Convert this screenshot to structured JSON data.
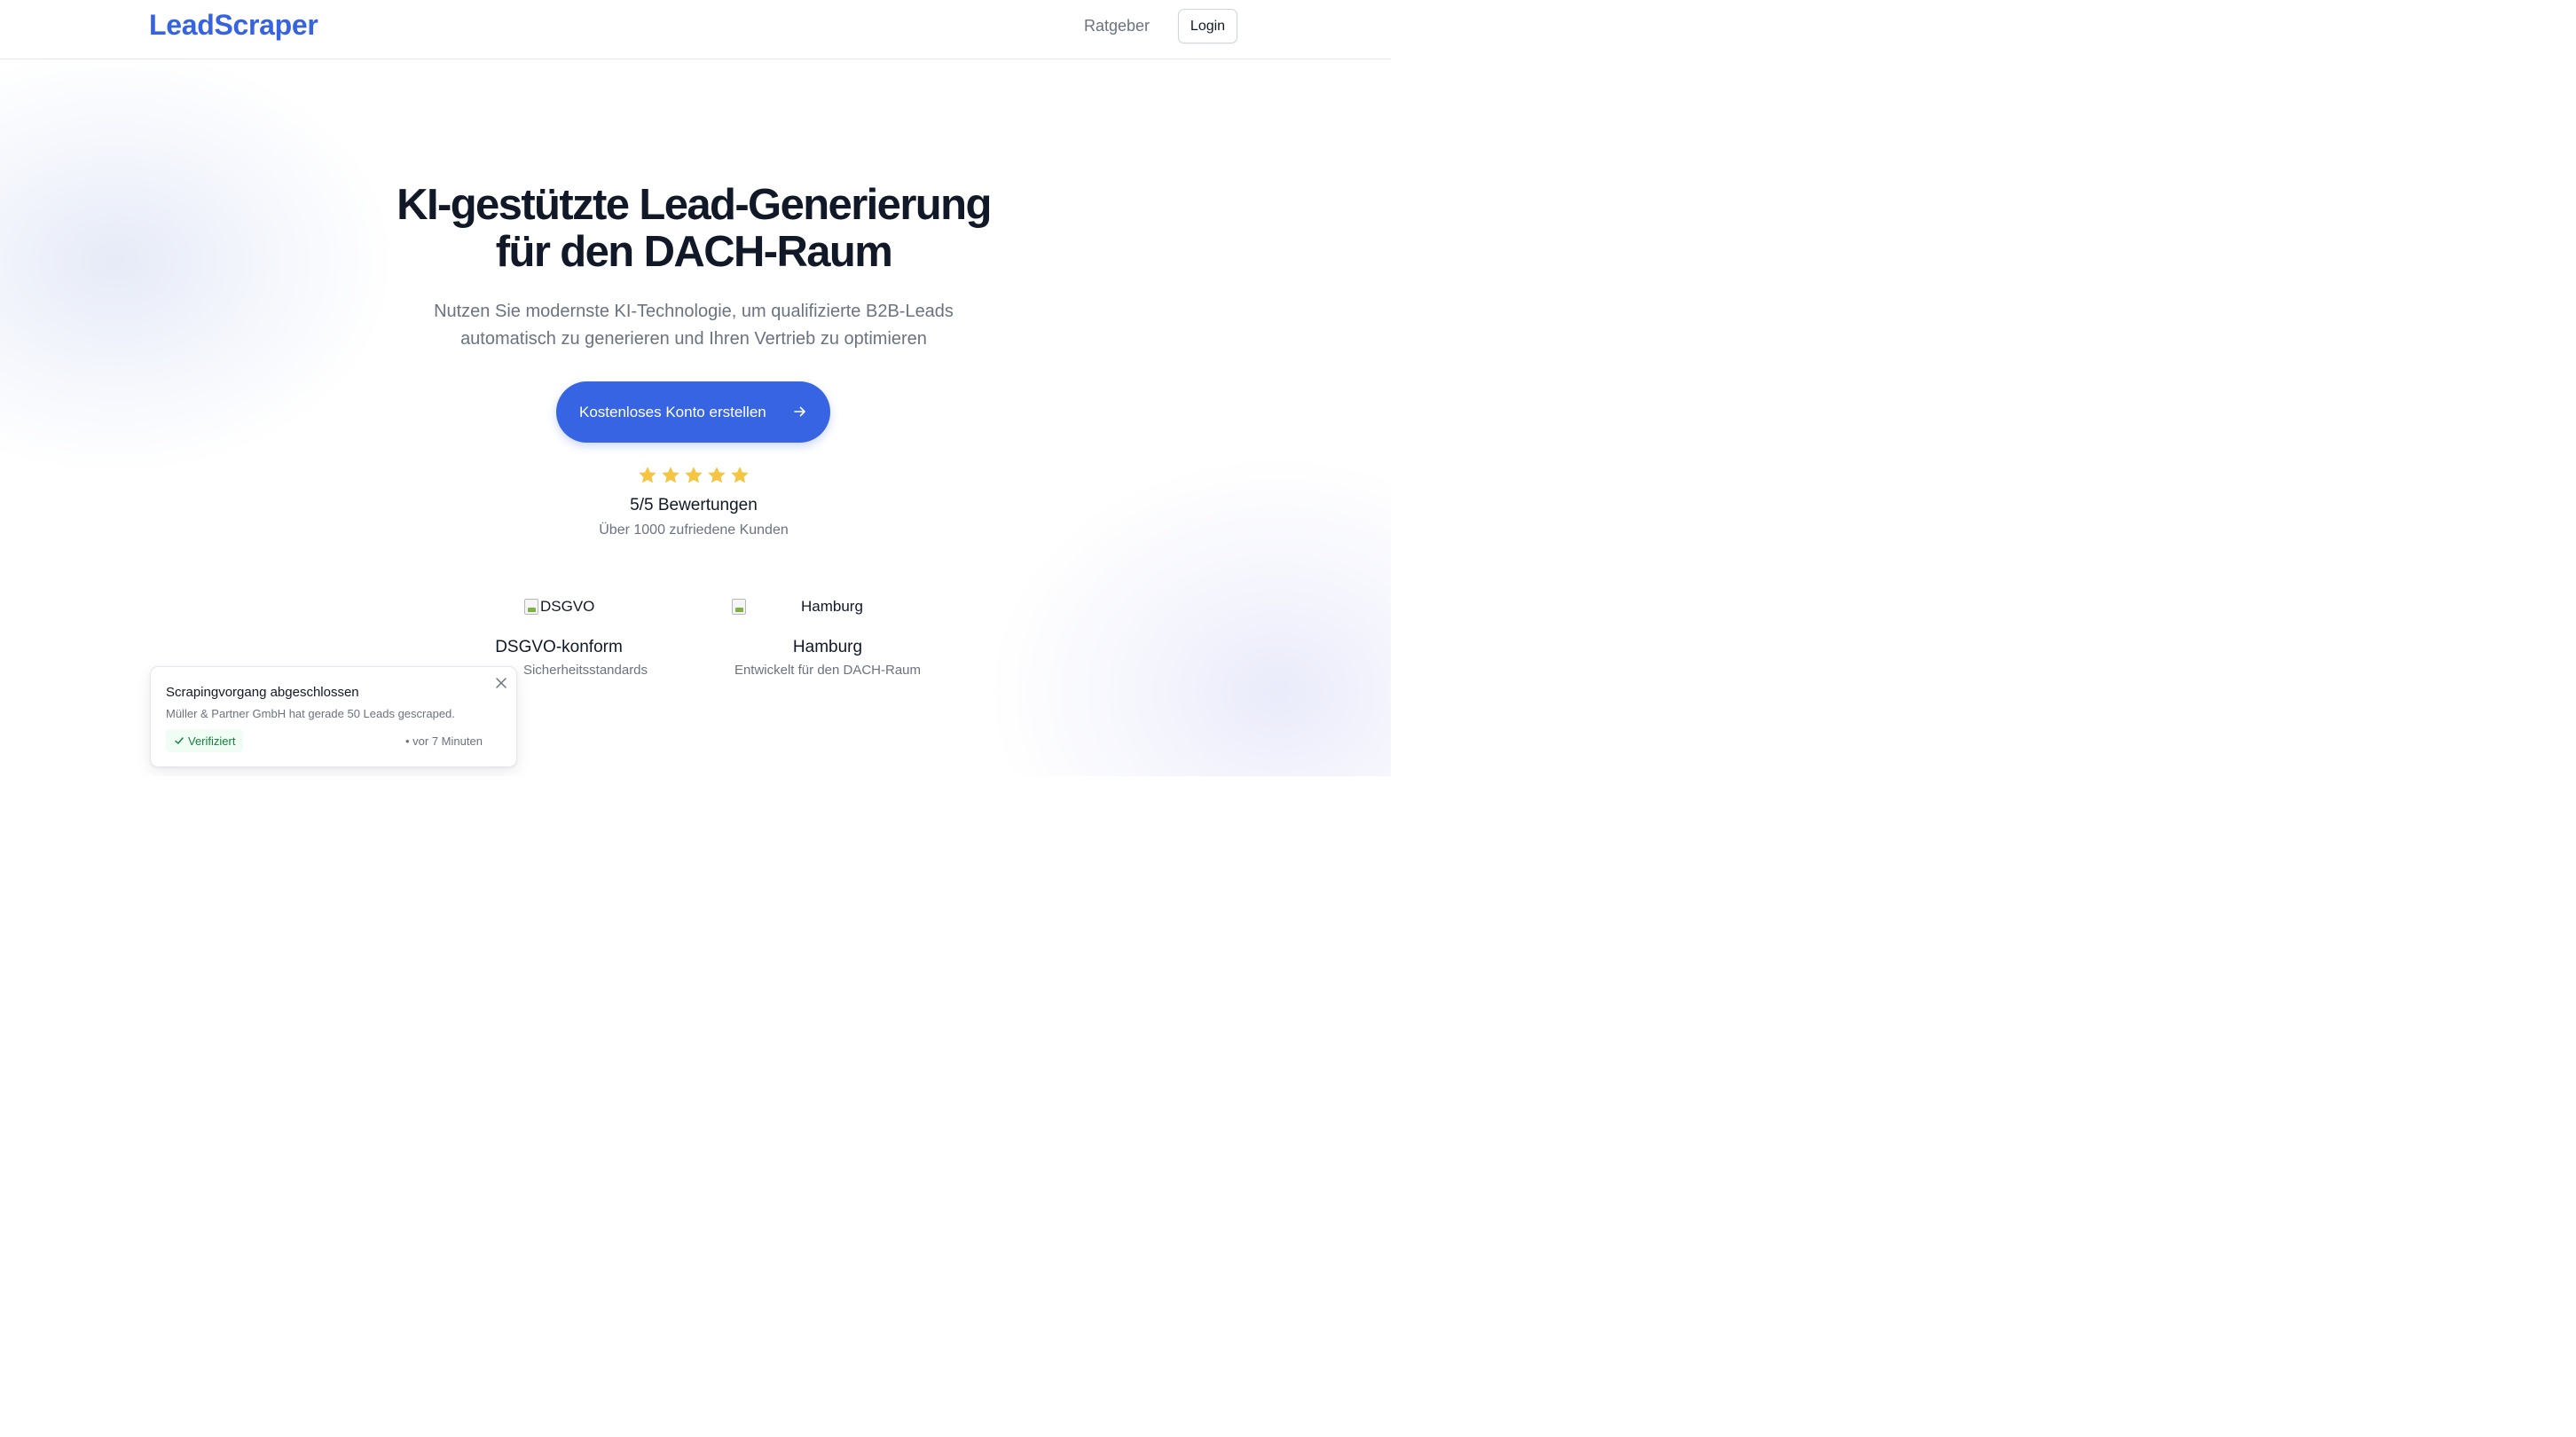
{
  "header": {
    "logo": "LeadScraper",
    "nav": {
      "ratgeber": "Ratgeber"
    },
    "login_label": "Login"
  },
  "hero": {
    "title_line1": "KI-gestützte Lead-Generierung",
    "title_line2": "für den DACH-Raum",
    "subtitle_line1": "Nutzen Sie modernste KI-Technologie, um qualifizierte B2B-Leads",
    "subtitle_line2": "automatisch zu generieren und Ihren Vertrieb zu optimieren",
    "cta_label": "Kostenloses Konto erstellen"
  },
  "rating": {
    "stars": 5,
    "max_stars": 5,
    "text": "5/5 Bewertungen",
    "sub": "Über 1000 zufriedene Kunden"
  },
  "badges": [
    {
      "img_alt": "DSGVO",
      "title": "DSGVO-konform",
      "sub": "Sicherheitsstandards"
    },
    {
      "img_alt": "Hamburg",
      "title": "Hamburg",
      "sub": "Entwickelt für den DACH-Raum"
    }
  ],
  "toast": {
    "title": "Scrapingvorgang abgeschlossen",
    "message": "Müller & Partner GmbH hat gerade 50 Leads gescraped.",
    "verified_label": "Verifiziert",
    "time": "• vor 7 Minuten"
  },
  "colors": {
    "accent": "#3764e2",
    "logo": "#3663e0",
    "star": "#f5c542",
    "verified_text": "#15803d",
    "verified_bg": "#f0fdf4"
  },
  "icons": {
    "cta": "arrow-right-icon",
    "rating": "star-icon",
    "toast_close": "close-icon",
    "verified": "check-icon"
  }
}
